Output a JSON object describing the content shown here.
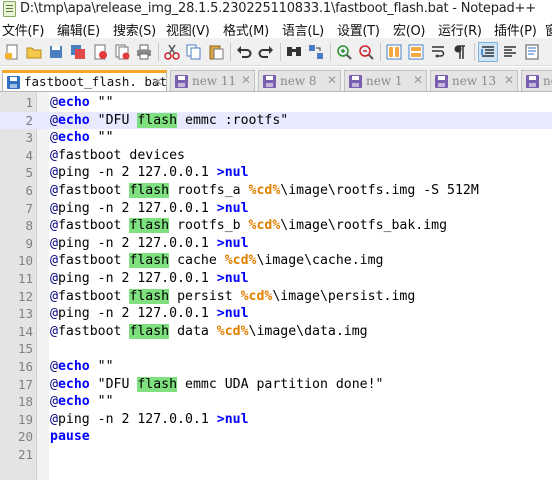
{
  "titlebar": {
    "title": "D:\\tmp\\apa\\release_img_28.1.5.230225110833.1\\fastboot_flash.bat - Notepad++"
  },
  "menu": {
    "items": [
      "文件(F)",
      "编辑(E)",
      "搜索(S)",
      "视图(V)",
      "格式(M)",
      "语言(L)",
      "设置(T)",
      "宏(O)",
      "运行(R)",
      "插件(P)",
      "窗"
    ]
  },
  "toolbar": {
    "icons": [
      "new-file-icon",
      "open-file-icon",
      "save-icon",
      "save-all-icon",
      "close-icon",
      "close-all-icon",
      "print-icon",
      "cut-icon",
      "copy-icon",
      "paste-icon",
      "undo-icon",
      "redo-icon",
      "find-icon",
      "replace-icon",
      "zoom-in-icon",
      "zoom-out-icon",
      "sync-vertical-icon",
      "sync-horizontal-icon",
      "word-wrap-icon",
      "show-all-chars-icon",
      "indent-guide-icon"
    ]
  },
  "tabs": [
    {
      "label": "fastboot_flash. bat",
      "close": "✕",
      "active": true,
      "icon_color": "blue"
    },
    {
      "label": "new  11",
      "close": "✕",
      "active": false,
      "icon_color": "purple"
    },
    {
      "label": "new  8",
      "close": "✕",
      "active": false,
      "icon_color": "purple"
    },
    {
      "label": "new  1",
      "close": "✕",
      "active": false,
      "icon_color": "purple"
    },
    {
      "label": "new  13",
      "close": "✕",
      "active": false,
      "icon_color": "purple"
    },
    {
      "label": "new",
      "close": "",
      "active": false,
      "icon_color": "purple"
    }
  ],
  "editor": {
    "current_line": 2,
    "lines": [
      {
        "num": "1",
        "text": "@echo \"\""
      },
      {
        "num": "2",
        "text": "@echo \"DFU flash emmc :rootfs\""
      },
      {
        "num": "3",
        "text": "@echo \"\""
      },
      {
        "num": "4",
        "text": "@fastboot devices"
      },
      {
        "num": "5",
        "text": "@ping -n 2 127.0.0.1 >nul"
      },
      {
        "num": "6",
        "text": "@fastboot flash rootfs_a %cd%\\image\\rootfs.img -S 512M"
      },
      {
        "num": "7",
        "text": "@ping -n 2 127.0.0.1 >nul"
      },
      {
        "num": "8",
        "text": "@fastboot flash rootfs_b %cd%\\image\\rootfs_bak.img"
      },
      {
        "num": "9",
        "text": "@ping -n 2 127.0.0.1 >nul"
      },
      {
        "num": "10",
        "text": "@fastboot flash cache %cd%\\image\\cache.img"
      },
      {
        "num": "11",
        "text": "@ping -n 2 127.0.0.1 >nul"
      },
      {
        "num": "12",
        "text": "@fastboot flash persist %cd%\\image\\persist.img"
      },
      {
        "num": "13",
        "text": "@ping -n 2 127.0.0.1 >nul"
      },
      {
        "num": "14",
        "text": "@fastboot flash data %cd%\\image\\data.img"
      },
      {
        "num": "15",
        "text": ""
      },
      {
        "num": "16",
        "text": "@echo \"\""
      },
      {
        "num": "17",
        "text": "@echo \"DFU flash emmc UDA partition done!\""
      },
      {
        "num": "18",
        "text": "@echo \"\""
      },
      {
        "num": "19",
        "text": "@ping -n 2 127.0.0.1 >nul"
      },
      {
        "num": "20",
        "text": "pause"
      },
      {
        "num": "21",
        "text": ""
      }
    ]
  },
  "colors": {
    "keyword": "#0000ff",
    "at_sign": "#000080",
    "variable": "#e08000",
    "flash_highlight": "#7fe07f",
    "current_line": "#e8e8ff",
    "tab_accent": "#f5a623"
  }
}
